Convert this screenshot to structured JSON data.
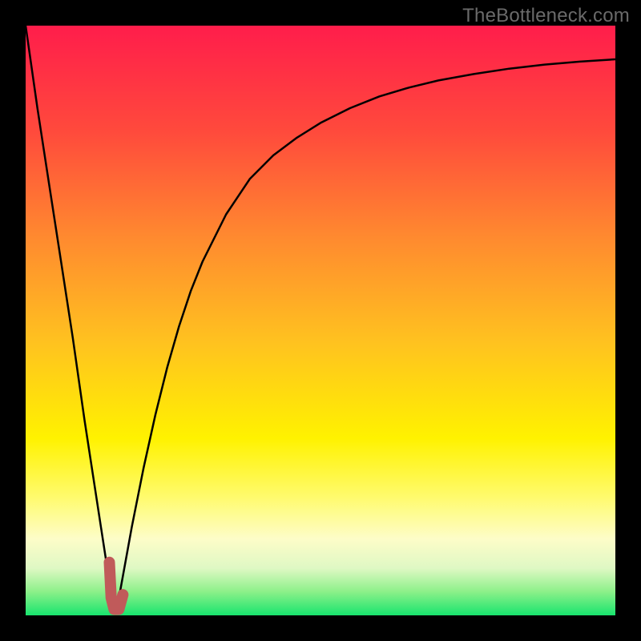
{
  "watermark": "TheBottleneck.com",
  "colors": {
    "line": "#000000",
    "marker": "#c05a5a",
    "frame": "#000000"
  },
  "chart_data": {
    "type": "line",
    "title": "",
    "xlabel": "",
    "ylabel": "",
    "xlim": [
      0,
      100
    ],
    "ylim": [
      0,
      100
    ],
    "series": [
      {
        "name": "bottleneck-curve",
        "x": [
          0,
          2,
          4,
          6,
          8,
          10,
          12,
          14,
          15,
          16,
          18,
          20,
          22,
          24,
          26,
          28,
          30,
          34,
          38,
          42,
          46,
          50,
          55,
          60,
          65,
          70,
          76,
          82,
          88,
          94,
          100
        ],
        "y": [
          100,
          86,
          73,
          60,
          47,
          33,
          20,
          7,
          1,
          4,
          15,
          25,
          34,
          42,
          49,
          55,
          60,
          68,
          74,
          78,
          81,
          83.5,
          86,
          88,
          89.5,
          90.7,
          91.8,
          92.7,
          93.4,
          93.9,
          94.3
        ]
      }
    ],
    "marker": {
      "name": "selected-point",
      "path_xy": [
        [
          14.2,
          9.0
        ],
        [
          14.5,
          3.0
        ],
        [
          15.0,
          1.0
        ],
        [
          15.8,
          1.0
        ],
        [
          16.5,
          3.5
        ]
      ]
    }
  }
}
